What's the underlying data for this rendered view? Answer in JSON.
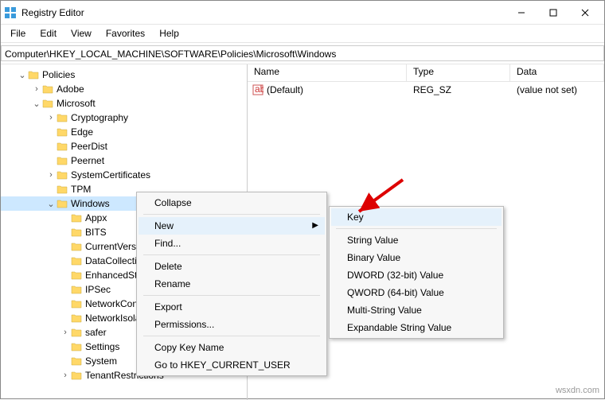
{
  "title": "Registry Editor",
  "menu": {
    "file": "File",
    "edit": "Edit",
    "view": "View",
    "favorites": "Favorites",
    "help": "Help"
  },
  "path": "Computer\\HKEY_LOCAL_MACHINE\\SOFTWARE\\Policies\\Microsoft\\Windows",
  "cols": {
    "name": "Name",
    "type": "Type",
    "data": "Data"
  },
  "row": {
    "name": "(Default)",
    "type": "REG_SZ",
    "data": "(value not set)"
  },
  "tree": {
    "policies": "Policies",
    "adobe": "Adobe",
    "microsoft": "Microsoft",
    "cryptography": "Cryptography",
    "edge": "Edge",
    "peerdist": "PeerDist",
    "peernet": "Peernet",
    "syscert": "SystemCertificates",
    "tpm": "TPM",
    "windows": "Windows",
    "appx": "Appx",
    "bits": "BITS",
    "curr": "CurrentVersion",
    "data": "DataCollection",
    "enha": "EnhancedStorageDevices",
    "ipsec": "IPSec",
    "netw1": "NetworkConnectivityStatusIndicator",
    "netw2": "NetworkIsolation",
    "safer": "safer",
    "setti": "Settings",
    "syste": "System",
    "tenant": "TenantRestrictions"
  },
  "ctx1": {
    "collapse": "Collapse",
    "new": "New",
    "find": "Find...",
    "delete": "Delete",
    "rename": "Rename",
    "export": "Export",
    "perm": "Permissions...",
    "copy": "Copy Key Name",
    "goto": "Go to HKEY_CURRENT_USER"
  },
  "ctx2": {
    "key": "Key",
    "string": "String Value",
    "binary": "Binary Value",
    "dword": "DWORD (32-bit) Value",
    "qword": "QWORD (64-bit) Value",
    "multi": "Multi-String Value",
    "exp": "Expandable String Value"
  },
  "watermark": "wsxdn.com"
}
